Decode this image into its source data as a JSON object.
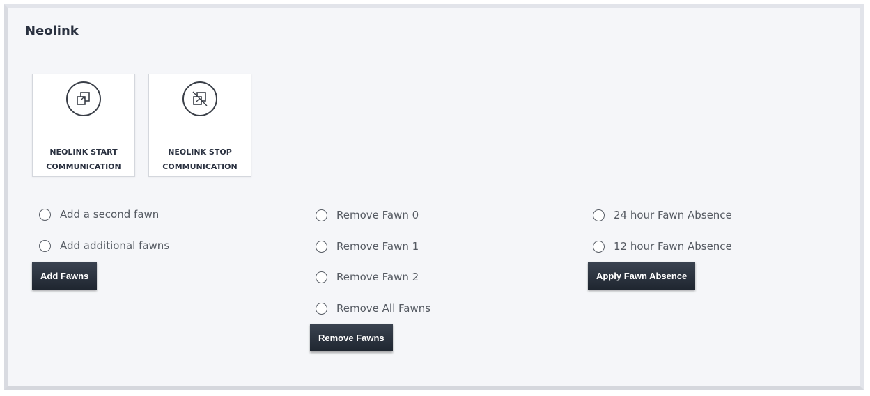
{
  "panel": {
    "title": "Neolink"
  },
  "tiles": [
    {
      "label": "NEOLINK START\nCOMMUNICATION",
      "icon": "window-restore-icon"
    },
    {
      "label": "NEOLINK STOP\nCOMMUNICATION",
      "icon": "window-close-icon"
    }
  ],
  "add_group": {
    "options": [
      "Add a second fawn",
      "Add additional fawns"
    ],
    "button_label": "Add Fawns"
  },
  "remove_group": {
    "options": [
      "Remove Fawn 0",
      "Remove Fawn 1",
      "Remove Fawn 2",
      "Remove All Fawns"
    ],
    "button_label": "Remove Fawns"
  },
  "absence_group": {
    "options": [
      "24 hour Fawn Absence",
      "12 hour Fawn Absence"
    ],
    "button_label": "Apply Fawn Absence"
  },
  "colors": {
    "button_bg": "#232a33",
    "panel_bg": "#f5f6f9"
  }
}
